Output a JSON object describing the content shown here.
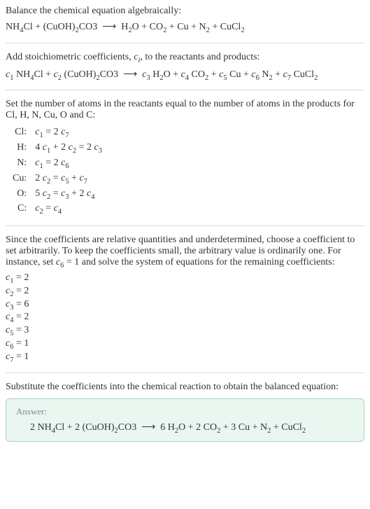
{
  "intro": {
    "line1": "Balance the chemical equation algebraically:",
    "equation_html": "NH<sub>4</sub>Cl + (CuOH)<sub>2</sub>CO3 &nbsp;⟶&nbsp; H<sub>2</sub>O + CO<sub>2</sub> + Cu + N<sub>2</sub> + CuCl<sub>2</sub>"
  },
  "stoich": {
    "line1_html": "Add stoichiometric coefficients, <i>c<sub>i</sub></i>, to the reactants and products:",
    "equation_html": "<i>c</i><sub>1</sub> NH<sub>4</sub>Cl + <i>c</i><sub>2</sub> (CuOH)<sub>2</sub>CO3 &nbsp;⟶&nbsp; <i>c</i><sub>3</sub> H<sub>2</sub>O + <i>c</i><sub>4</sub> CO<sub>2</sub> + <i>c</i><sub>5</sub> Cu + <i>c</i><sub>6</sub> N<sub>2</sub> + <i>c</i><sub>7</sub> CuCl<sub>2</sub>"
  },
  "atoms": {
    "intro": "Set the number of atoms in the reactants equal to the number of atoms in the products for Cl, H, N, Cu, O and C:",
    "rows": [
      {
        "label": "Cl:",
        "eq_html": "<i>c</i><sub>1</sub> = 2 <i>c</i><sub>7</sub>"
      },
      {
        "label": "H:",
        "eq_html": "4 <i>c</i><sub>1</sub> + 2 <i>c</i><sub>2</sub> = 2 <i>c</i><sub>3</sub>"
      },
      {
        "label": "N:",
        "eq_html": "<i>c</i><sub>1</sub> = 2 <i>c</i><sub>6</sub>"
      },
      {
        "label": "Cu:",
        "eq_html": "2 <i>c</i><sub>2</sub> = <i>c</i><sub>5</sub> + <i>c</i><sub>7</sub>"
      },
      {
        "label": "O:",
        "eq_html": "5 <i>c</i><sub>2</sub> = <i>c</i><sub>3</sub> + 2 <i>c</i><sub>4</sub>"
      },
      {
        "label": "C:",
        "eq_html": "<i>c</i><sub>2</sub> = <i>c</i><sub>4</sub>"
      }
    ]
  },
  "solve": {
    "intro_html": "Since the coefficients are relative quantities and underdetermined, choose a coefficient to set arbitrarily. To keep the coefficients small, the arbitrary value is ordinarily one. For instance, set <i>c</i><sub>6</sub> = 1 and solve the system of equations for the remaining coefficients:",
    "coefs": [
      {
        "html": "<i>c</i><sub>1</sub> = 2"
      },
      {
        "html": "<i>c</i><sub>2</sub> = 2"
      },
      {
        "html": "<i>c</i><sub>3</sub> = 6"
      },
      {
        "html": "<i>c</i><sub>4</sub> = 2"
      },
      {
        "html": "<i>c</i><sub>5</sub> = 3"
      },
      {
        "html": "<i>c</i><sub>6</sub> = 1"
      },
      {
        "html": "<i>c</i><sub>7</sub> = 1"
      }
    ]
  },
  "substitute": {
    "intro": "Substitute the coefficients into the chemical reaction to obtain the balanced equation:"
  },
  "answer": {
    "label": "Answer:",
    "equation_html": "2 NH<sub>4</sub>Cl + 2 (CuOH)<sub>2</sub>CO3 &nbsp;⟶&nbsp; 6 H<sub>2</sub>O + 2 CO<sub>2</sub> + 3 Cu + N<sub>2</sub> + CuCl<sub>2</sub>"
  }
}
